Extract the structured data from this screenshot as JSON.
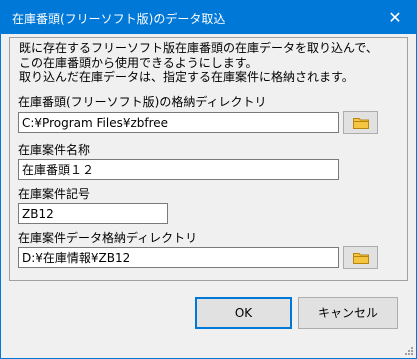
{
  "window": {
    "title": "在庫番頭(フリーソフト版)のデータ取込"
  },
  "description": {
    "lines": [
      "既に存在するフリーソフト版在庫番頭の在庫データを取り込んで、",
      "この在庫番頭から使用できるようにします。",
      "取り込んだ在庫データは、指定する在庫案件に格納されます。"
    ]
  },
  "source_dir": {
    "label": "在庫番頭(フリーソフト版)の格納ディレクトリ",
    "value": "C:¥Program Files¥zbfree"
  },
  "case_name": {
    "label": "在庫案件名称",
    "value": "在庫番頭１２"
  },
  "case_code": {
    "label": "在庫案件記号",
    "value": "ZB12"
  },
  "case_dir": {
    "label": "在庫案件データ格納ディレクトリ",
    "value": "D:¥在庫情報¥ZB12"
  },
  "buttons": {
    "ok": "OK",
    "cancel": "キャンセル"
  },
  "icons": {
    "close": "close-icon",
    "folder": "folder-icon",
    "resize": "resize-grip-icon"
  },
  "colors": {
    "titlebar": "#0078d7",
    "folder": "#f5c542"
  }
}
